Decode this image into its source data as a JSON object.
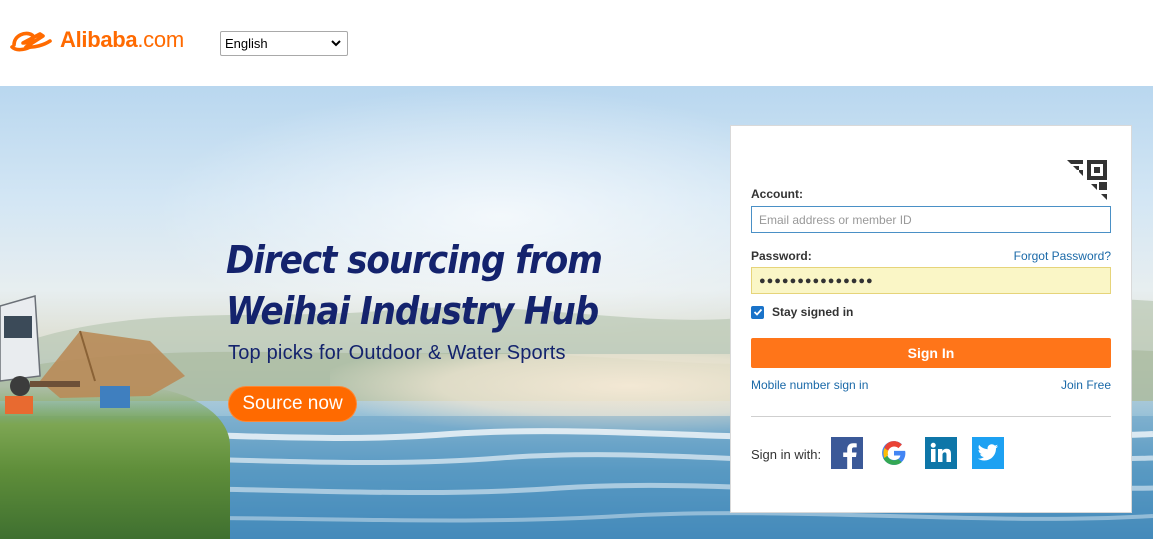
{
  "header": {
    "logo_text": "Alibaba",
    "logo_suffix": ".com",
    "language_selected": "English"
  },
  "hero": {
    "headline_line1": "Direct sourcing from",
    "headline_line2": "Weihai Industry Hub",
    "subline": "Top picks for Outdoor & Water Sports",
    "cta_label": "Source now"
  },
  "login": {
    "account_label": "Account:",
    "account_placeholder": "Email address or member ID",
    "password_label": "Password:",
    "forgot_label": "Forgot Password?",
    "password_value": "●●●●●●●●●●●●●●●",
    "stay_signed_in_label": "Stay signed in",
    "stay_signed_in_checked": true,
    "signin_label": "Sign In",
    "mobile_signin_label": "Mobile number sign in",
    "join_label": "Join Free",
    "signin_with_label": "Sign in with:",
    "social": [
      "facebook-icon",
      "google-icon",
      "linkedin-icon",
      "twitter-icon"
    ]
  },
  "colors": {
    "brand": "#ff6a00",
    "link": "#1a69a8",
    "headline": "#14236d"
  }
}
